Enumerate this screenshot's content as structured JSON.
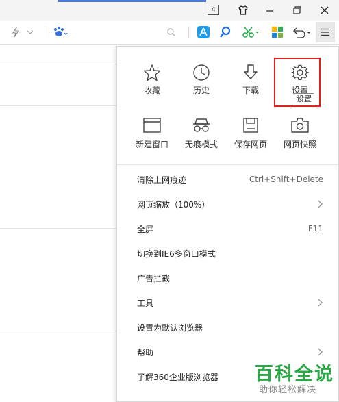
{
  "titlebar": {
    "tab_count": "4",
    "icons": [
      "skin-icon",
      "minimize-icon",
      "restore-icon",
      "close-icon"
    ]
  },
  "toolbar": {
    "icons": [
      "lightning-icon",
      "chevron-down-icon",
      "paw-icon",
      "search-icon",
      "translate-icon",
      "magnifier-icon",
      "scissors-icon",
      "apps-icon",
      "undo-icon",
      "menu-icon"
    ]
  },
  "menu": {
    "grid": [
      {
        "label": "收藏",
        "icon": "star-icon"
      },
      {
        "label": "历史",
        "icon": "clock-icon"
      },
      {
        "label": "下载",
        "icon": "download-icon"
      },
      {
        "label": "设置",
        "icon": "gear-icon"
      },
      {
        "label": "新建窗口",
        "icon": "window-icon"
      },
      {
        "label": "无痕模式",
        "icon": "incognito-icon"
      },
      {
        "label": "保存网页",
        "icon": "save-icon"
      },
      {
        "label": "网页快照",
        "icon": "camera-icon"
      }
    ],
    "tooltip": "设置",
    "items": [
      {
        "label": "清除上网痕迹",
        "right": "Ctrl+Shift+Delete"
      },
      {
        "label": "网页缩放（100%）",
        "right": ""
      },
      {
        "label": "全屏",
        "right": "F11"
      },
      {
        "label": "切换到IE6多窗口模式",
        "right": ""
      },
      {
        "label": "广告拦截",
        "right": ""
      },
      {
        "label": "工具",
        "right": ""
      },
      {
        "label": "设置为默认浏览器",
        "right": ""
      },
      {
        "label": "帮助",
        "right": ""
      },
      {
        "label": "了解360企业版浏览器",
        "right": ""
      }
    ]
  },
  "watermark": {
    "title": "百科全说",
    "subtitle": "助你轻松解决"
  },
  "colors": {
    "highlight": "#e02020",
    "watermark_green": "#2aa846"
  }
}
